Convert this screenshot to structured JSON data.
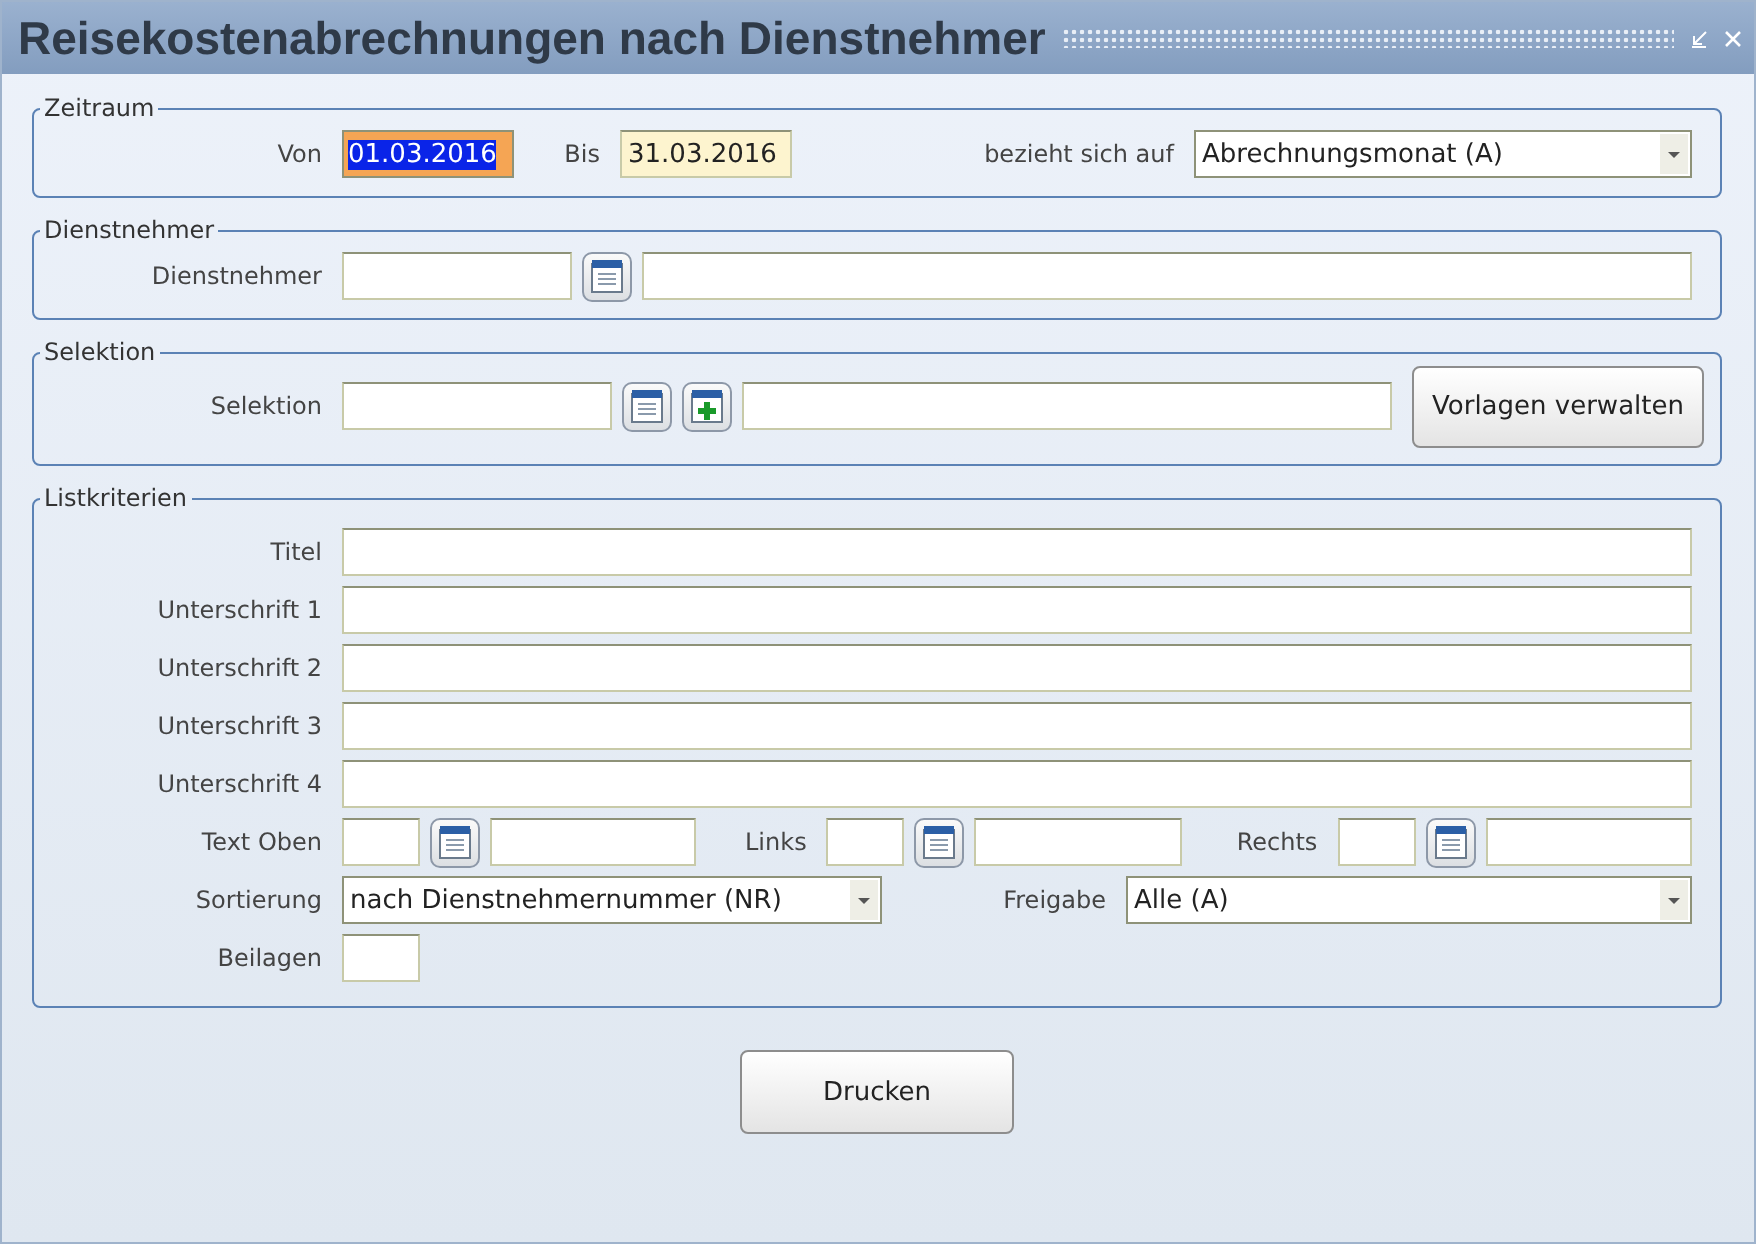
{
  "window": {
    "title": "Reisekostenabrechnungen nach Dienstnehmer"
  },
  "zeitraum": {
    "legend": "Zeitraum",
    "von": {
      "label": "Von",
      "value": "01.03.2016",
      "focused": true
    },
    "bis": {
      "label": "Bis",
      "value": "31.03.2016",
      "focused": false
    },
    "bezug": {
      "label": "bezieht sich auf",
      "value": "Abrechnungsmonat (A)"
    }
  },
  "dienstnehmer": {
    "legend": "Dienstnehmer",
    "label": "Dienstnehmer"
  },
  "selektion": {
    "legend": "Selektion",
    "label": "Selektion",
    "button": "Vorlagen verwalten"
  },
  "listkriterien": {
    "legend": "Listkriterien",
    "text_rows": [
      "Titel",
      "Unterschrift 1",
      "Unterschrift 2",
      "Unterschrift 3",
      "Unterschrift 4"
    ],
    "text_fields": [
      {
        "label": "Text Oben"
      },
      {
        "label": "Links"
      },
      {
        "label": "Rechts"
      }
    ],
    "sortierung": {
      "label": "Sortierung",
      "value": "nach Dienstnehmernummer (NR)"
    },
    "freigabe": {
      "label": "Freigabe",
      "value": "Alle (A)"
    },
    "beilagen": {
      "label": "Beilagen"
    }
  },
  "buttons": [
    "Drucken"
  ]
}
